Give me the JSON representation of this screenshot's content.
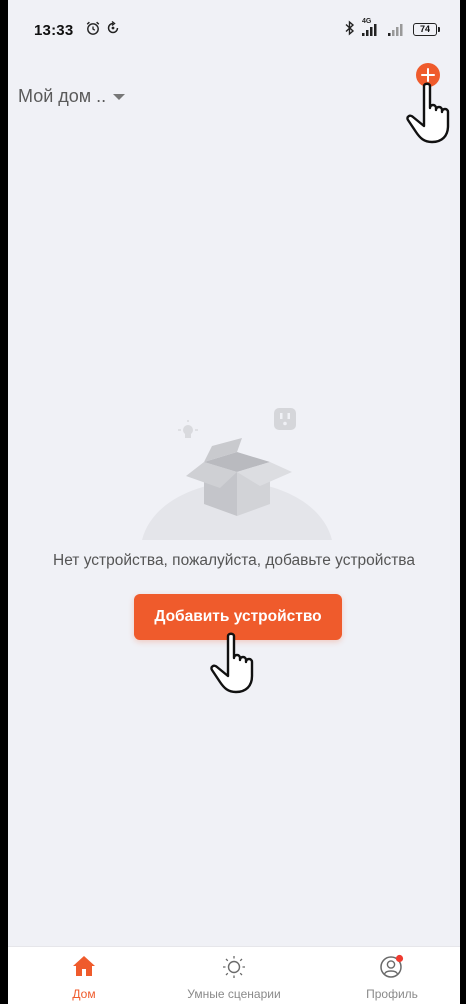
{
  "status_bar": {
    "time": "13:33",
    "network": "4G",
    "battery": "74",
    "icons": [
      "alarm-icon",
      "sync-icon",
      "bluetooth-icon",
      "signal-icon",
      "signal-icon-2",
      "battery-icon"
    ]
  },
  "header": {
    "home_name": "Мой дом ..",
    "dropdown_icon": "caret-down-icon",
    "add_icon": "plus-circle-icon"
  },
  "empty_state": {
    "message": "Нет устройства, пожалуйста, добавьте устройства",
    "button_label": "Добавить устройство",
    "illustration": "empty-box-illustration"
  },
  "tab_bar": {
    "tabs": [
      {
        "label": "Дом",
        "icon": "home-icon",
        "active": true
      },
      {
        "label": "Умные сценарии",
        "icon": "sun-icon",
        "active": false
      },
      {
        "label": "Профиль",
        "icon": "profile-icon",
        "active": false,
        "badge": true
      }
    ]
  },
  "colors": {
    "accent": "#ef5b2c",
    "background": "#f0f1f6",
    "tab_inactive": "#8a8a8a"
  }
}
